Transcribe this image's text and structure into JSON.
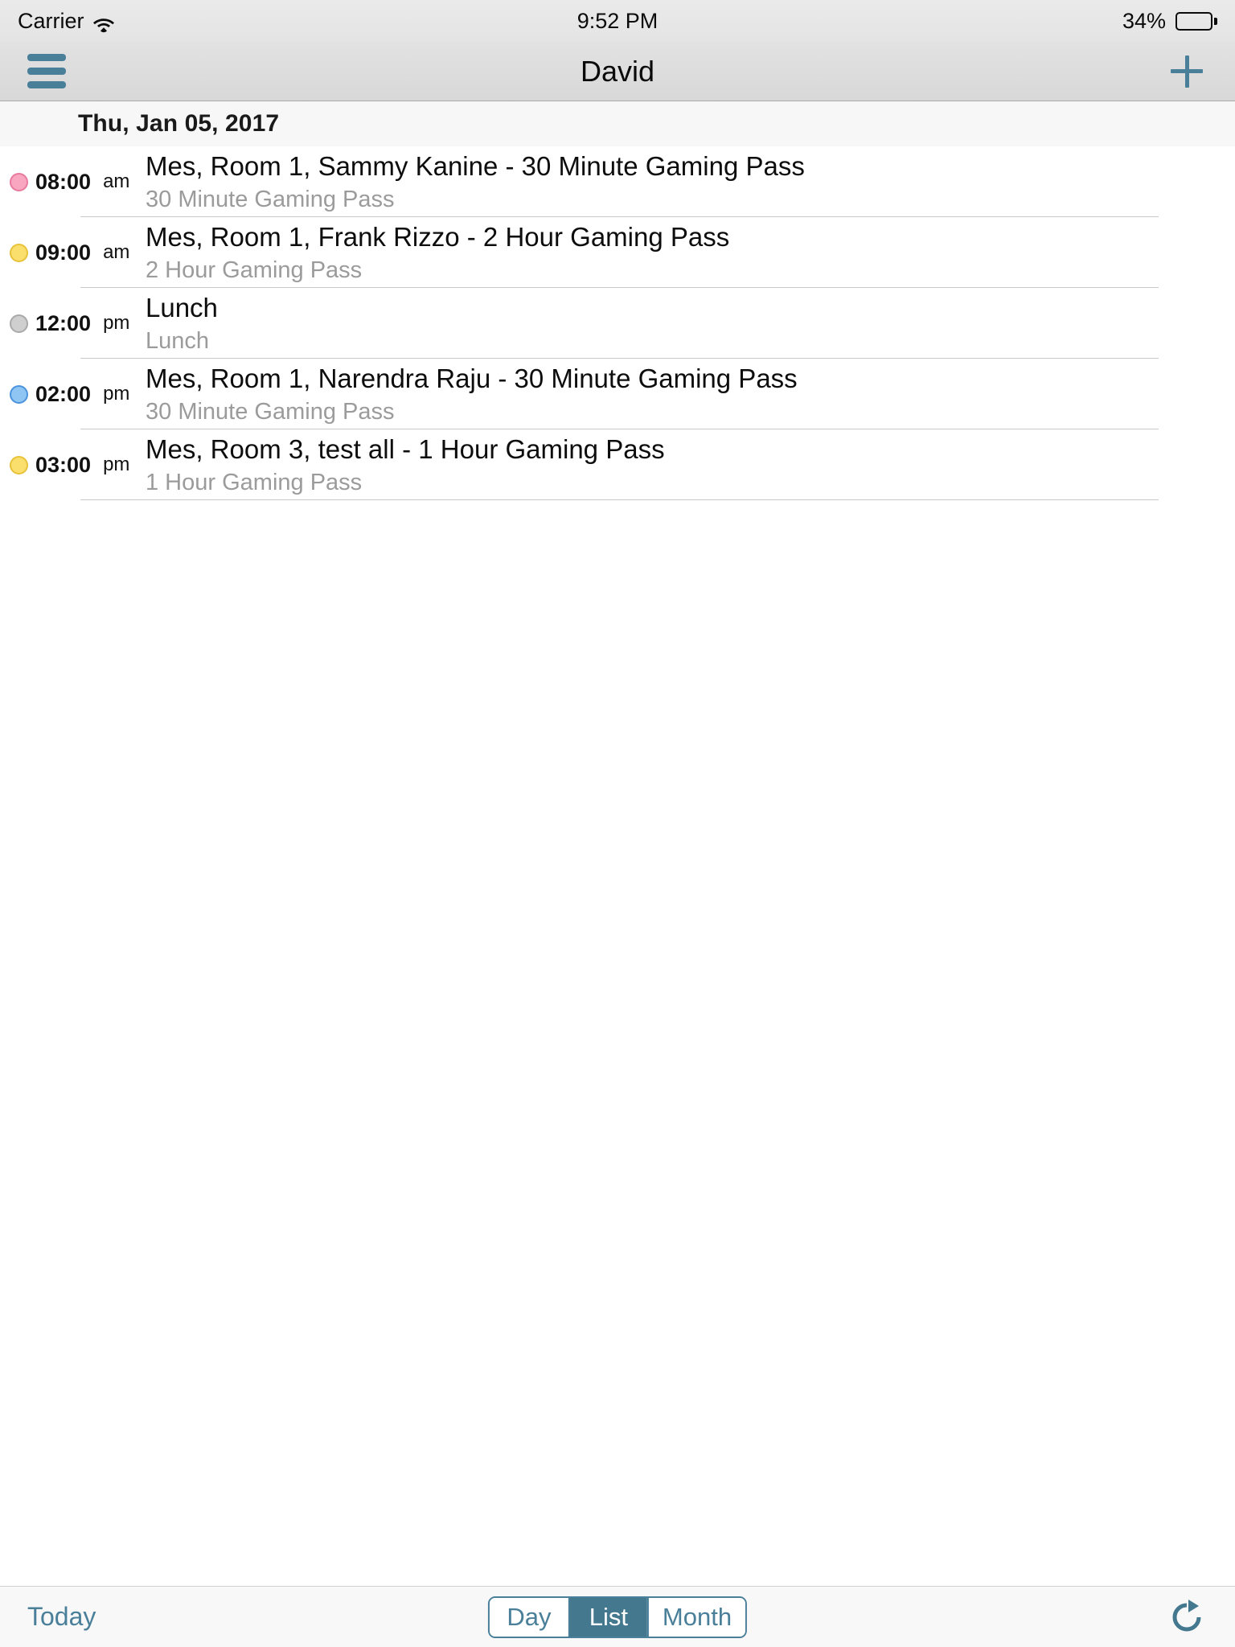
{
  "status_bar": {
    "carrier": "Carrier",
    "wifi_icon": "wifi-icon",
    "time": "9:52 PM",
    "battery_percent": "34%",
    "battery_level": 34,
    "battery_icon": "battery-icon"
  },
  "nav_bar": {
    "menu_icon": "hamburger-menu-icon",
    "title": "David",
    "add_icon": "plus-icon",
    "accent_color": "#4a7f99"
  },
  "date_header": {
    "label": "Thu, Jan 05, 2017"
  },
  "events": [
    {
      "time": "08:00",
      "suffix": "am",
      "title": "Mes, Room 1, Sammy Kanine - 30 Minute Gaming Pass",
      "subtitle": "30 Minute Gaming Pass",
      "dot_color": "#f9a7c0",
      "dot_class": "dot-pink"
    },
    {
      "time": "09:00",
      "suffix": "am",
      "title": "Mes, Room 1, Frank Rizzo - 2 Hour Gaming Pass",
      "subtitle": "2 Hour Gaming Pass",
      "dot_color": "#fbdf6d",
      "dot_class": "dot-yellow"
    },
    {
      "time": "12:00",
      "suffix": "pm",
      "title": "Lunch",
      "subtitle": "Lunch",
      "dot_color": "#cfcfcf",
      "dot_class": "dot-gray"
    },
    {
      "time": "02:00",
      "suffix": "pm",
      "title": "Mes, Room 1, Narendra Raju - 30 Minute Gaming Pass",
      "subtitle": "30 Minute Gaming Pass",
      "dot_color": "#8ec5f2",
      "dot_class": "dot-blue"
    },
    {
      "time": "03:00",
      "suffix": "pm",
      "title": "Mes, Room 3, test all - 1 Hour Gaming Pass",
      "subtitle": "1 Hour Gaming Pass",
      "dot_color": "#fbdf6d",
      "dot_class": "dot-yellow"
    }
  ],
  "toolbar": {
    "today_label": "Today",
    "segments": [
      {
        "label": "Day",
        "selected": false
      },
      {
        "label": "List",
        "selected": true
      },
      {
        "label": "Month",
        "selected": false
      }
    ],
    "refresh_icon": "refresh-icon",
    "selected_color": "#43788f"
  }
}
